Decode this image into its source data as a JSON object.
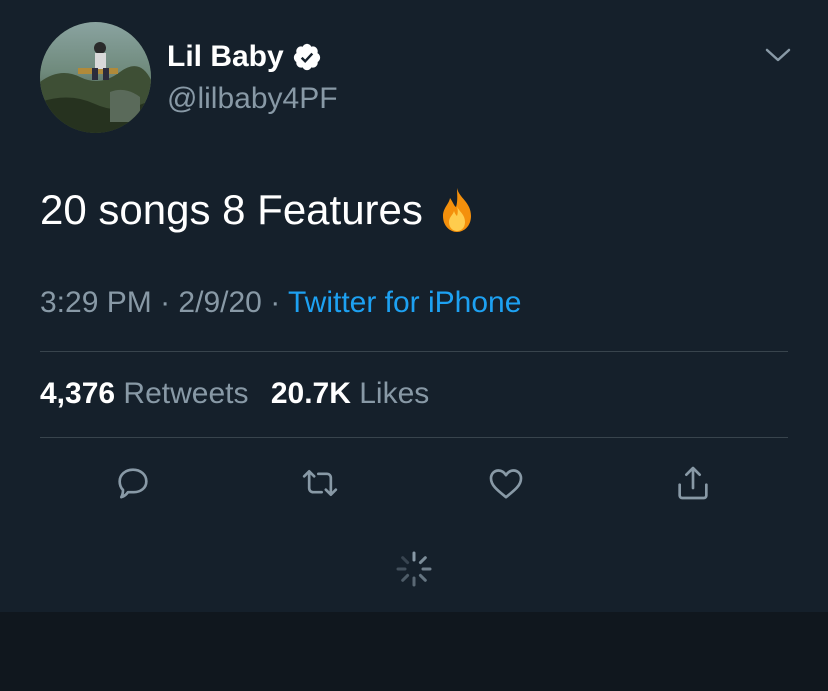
{
  "user": {
    "display_name": "Lil Baby",
    "handle": "@lilbaby4PF",
    "verified": true
  },
  "tweet": {
    "text": "20 songs 8 Features",
    "emoji": "fire",
    "time": "3:29 PM",
    "separator": "·",
    "date": "2/9/20",
    "source": "Twitter for iPhone"
  },
  "stats": {
    "retweets_count": "4,376",
    "retweets_label": "Retweets",
    "likes_count": "20.7K",
    "likes_label": "Likes"
  },
  "actions": [
    "reply-icon",
    "retweet-icon",
    "like-icon",
    "share-icon"
  ],
  "colors": {
    "background": "#15202b",
    "text": "#ffffff",
    "secondary": "#8899a6",
    "link": "#1da1f2",
    "divider": "#38444d"
  }
}
